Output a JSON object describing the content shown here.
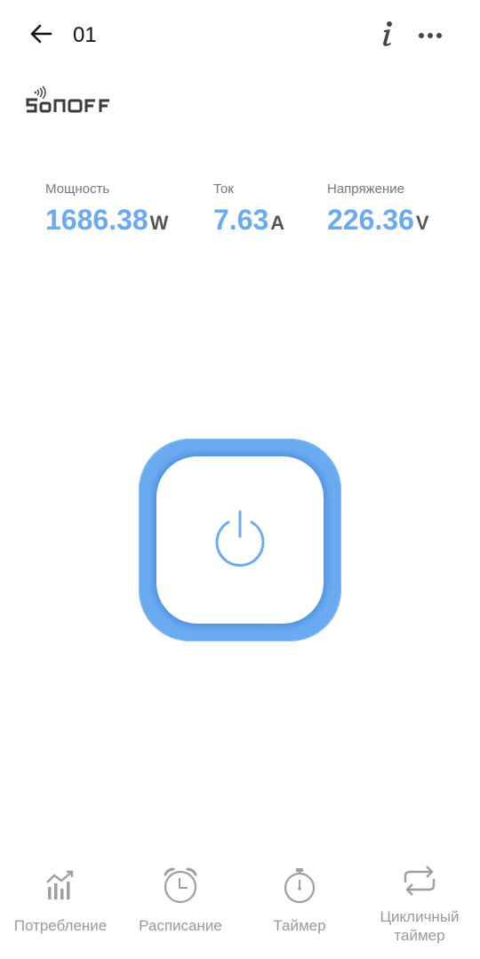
{
  "header": {
    "title": "01",
    "back_icon": "arrow-left-icon",
    "info_icon": "info-icon",
    "more_icon": "more-dots-icon"
  },
  "brand": {
    "logo_text": "SONOFF"
  },
  "metrics": [
    {
      "label": "Мощность",
      "value": "1686.38",
      "unit": "W"
    },
    {
      "label": "Ток",
      "value": "7.63",
      "unit": "A"
    },
    {
      "label": "Напряжение",
      "value": "226.36",
      "unit": "V"
    }
  ],
  "power": {
    "icon": "power-icon",
    "accent_color": "#6aaaf0"
  },
  "nav": [
    {
      "label": "Потребление",
      "icon": "chart-icon"
    },
    {
      "label": "Расписание",
      "icon": "alarm-clock-icon"
    },
    {
      "label": "Таймер",
      "icon": "stopwatch-icon"
    },
    {
      "label": "Цикличный таймер",
      "icon": "repeat-icon"
    }
  ],
  "colors": {
    "accent": "#6aaaf0",
    "label": "#777777",
    "nav_label": "#999999"
  }
}
